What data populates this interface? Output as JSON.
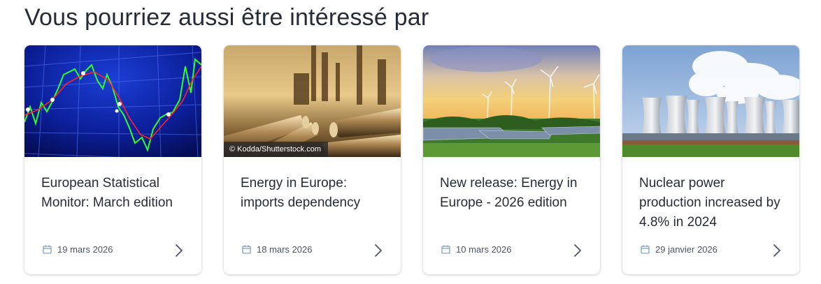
{
  "section": {
    "title": "Vous pourriez aussi être intéressé par"
  },
  "cards": [
    {
      "title": "European Statistical Monitor: March edition",
      "date": "19 mars 2026",
      "image": "stock-chart"
    },
    {
      "title": "Energy in Europe: imports dependency",
      "date": "18 mars 2026",
      "image": "pipelines",
      "credit": "© Kodda/Shutterstock.com"
    },
    {
      "title": "New release: Energy in Europe - 2026 edition",
      "date": "10 mars 2026",
      "image": "wind-solar-farm"
    },
    {
      "title": "Nuclear power production increased by 4.8% in 2024",
      "date": "29 janvier 2026",
      "image": "cooling-towers"
    }
  ],
  "icons": {
    "date": "calendar-icon",
    "open": "chevron-right-icon"
  },
  "colors": {
    "text": "#262b38",
    "meta": "#4d5364",
    "accent_icon": "#6b8fb3"
  }
}
